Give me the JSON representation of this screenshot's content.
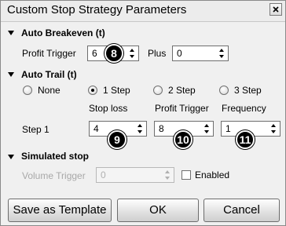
{
  "window": {
    "title": "Custom Stop Strategy Parameters",
    "close_icon": "close-icon"
  },
  "auto_breakeven": {
    "heading": "Auto Breakeven (t)",
    "profit_trigger_label": "Profit Trigger",
    "profit_trigger_value": "6",
    "plus_label": "Plus",
    "plus_value": "0",
    "badge": "8"
  },
  "auto_trail": {
    "heading": "Auto Trail (t)",
    "options": [
      {
        "label": "None",
        "checked": false
      },
      {
        "label": "1 Step",
        "checked": true
      },
      {
        "label": "2 Step",
        "checked": false
      },
      {
        "label": "3 Step",
        "checked": false
      }
    ],
    "columns": [
      "Stop loss",
      "Profit Trigger",
      "Frequency"
    ],
    "step1_label": "Step 1",
    "step1_values": [
      "4",
      "8",
      "1"
    ],
    "badges": [
      "9",
      "10",
      "11"
    ]
  },
  "simulated_stop": {
    "heading": "Simulated stop",
    "volume_trigger_label": "Volume Trigger",
    "volume_trigger_value": "0",
    "enabled_label": "Enabled"
  },
  "buttons": {
    "save_template": "Save as Template",
    "ok": "OK",
    "cancel": "Cancel"
  },
  "colors": {
    "background": "#f0f0f0",
    "badge": "#000000",
    "disabled_text": "#a8a8a8"
  }
}
